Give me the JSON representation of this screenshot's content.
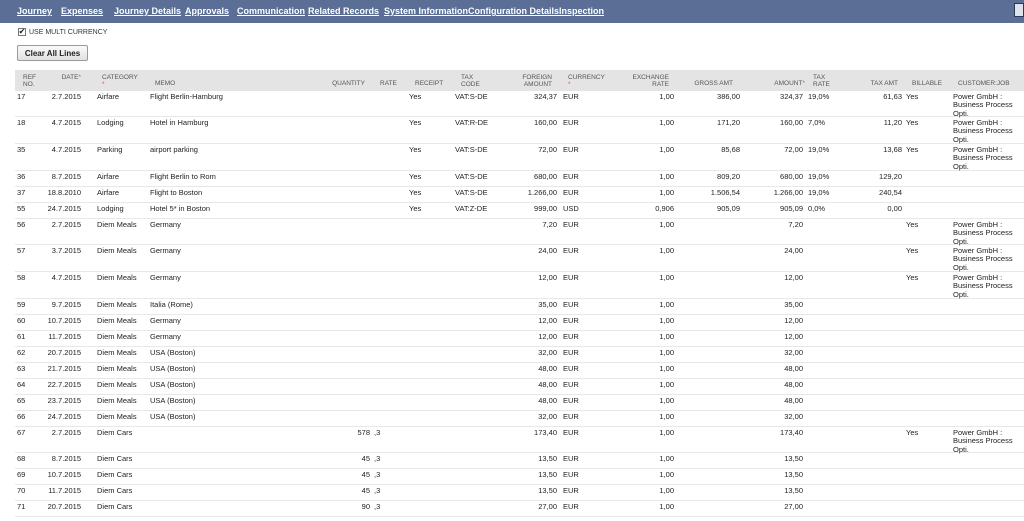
{
  "tabs": [
    {
      "label": "Journey",
      "active": false
    },
    {
      "label": "Expenses",
      "active": true
    },
    {
      "label": "Journey Details",
      "active": false
    },
    {
      "label": "Approvals",
      "active": false
    },
    {
      "label": "Communication",
      "active": false
    },
    {
      "label": "Related Records",
      "active": false
    },
    {
      "label": "System Information",
      "active": false
    },
    {
      "label": "Configuration Details",
      "active": false
    },
    {
      "label": "Inspection",
      "active": false
    }
  ],
  "multi_currency": {
    "label": "USE MULTI CURRENCY",
    "checked": true,
    "check_glyph": "✔"
  },
  "clear_all_lines_label": "Clear All Lines",
  "required_mark": "*",
  "columns": {
    "ref": "REF NO.",
    "date": "DATE",
    "category": "CATEGORY",
    "memo": "MEMO",
    "quantity": "QUANTITY",
    "rate": "RATE",
    "receipt": "RECEIPT",
    "tax_code": "TAX CODE",
    "foreign_amount": "FOREIGN AMOUNT",
    "currency": "CURRENCY",
    "exchange_rate": "EXCHANGE RATE",
    "gross_amt": "GROSS AMT",
    "amount": "AMOUNT",
    "tax_rate": "TAX RATE",
    "tax_amt": "TAX AMT",
    "billable": "BILLABLE",
    "customer_job": "CUSTOMER:JOB"
  },
  "rows": [
    {
      "ref": "17",
      "date": "2.7.2015",
      "category": "Airfare",
      "memo": "Flight Berlin-Hamburg",
      "quantity": "",
      "rate": "",
      "receipt": "Yes",
      "tax_code": "VAT:S-DE",
      "foreign_amount": "324,37",
      "currency": "EUR",
      "exchange_rate": "1,00",
      "gross_amt": "386,00",
      "amount": "324,37",
      "tax_rate": "19,0%",
      "tax_amt": "61,63",
      "billable": "Yes",
      "customer_job": "Power GmbH : Business Process Opti."
    },
    {
      "ref": "18",
      "date": "4.7.2015",
      "category": "Lodging",
      "memo": "Hotel in Hamburg",
      "quantity": "",
      "rate": "",
      "receipt": "Yes",
      "tax_code": "VAT:R-DE",
      "foreign_amount": "160,00",
      "currency": "EUR",
      "exchange_rate": "1,00",
      "gross_amt": "171,20",
      "amount": "160,00",
      "tax_rate": "7,0%",
      "tax_amt": "11,20",
      "billable": "Yes",
      "customer_job": "Power GmbH : Business Process Opti."
    },
    {
      "ref": "35",
      "date": "4.7.2015",
      "category": "Parking",
      "memo": "airport parking",
      "quantity": "",
      "rate": "",
      "receipt": "Yes",
      "tax_code": "VAT:S-DE",
      "foreign_amount": "72,00",
      "currency": "EUR",
      "exchange_rate": "1,00",
      "gross_amt": "85,68",
      "amount": "72,00",
      "tax_rate": "19,0%",
      "tax_amt": "13,68",
      "billable": "Yes",
      "customer_job": "Power GmbH : Business Process Opti."
    },
    {
      "ref": "36",
      "date": "8.7.2015",
      "category": "Airfare",
      "memo": "Flight Berlin to Rom",
      "quantity": "",
      "rate": "",
      "receipt": "Yes",
      "tax_code": "VAT:S-DE",
      "foreign_amount": "680,00",
      "currency": "EUR",
      "exchange_rate": "1,00",
      "gross_amt": "809,20",
      "amount": "680,00",
      "tax_rate": "19,0%",
      "tax_amt": "129,20",
      "billable": "",
      "customer_job": ""
    },
    {
      "ref": "37",
      "date": "18.8.2010",
      "category": "Airfare",
      "memo": "Flight to Boston",
      "quantity": "",
      "rate": "",
      "receipt": "Yes",
      "tax_code": "VAT:S-DE",
      "foreign_amount": "1.266,00",
      "currency": "EUR",
      "exchange_rate": "1,00",
      "gross_amt": "1.506,54",
      "amount": "1.266,00",
      "tax_rate": "19,0%",
      "tax_amt": "240,54",
      "billable": "",
      "customer_job": ""
    },
    {
      "ref": "55",
      "date": "24.7.2015",
      "category": "Lodging",
      "memo": "Hotel 5* in Boston",
      "quantity": "",
      "rate": "",
      "receipt": "Yes",
      "tax_code": "VAT:Z-DE",
      "foreign_amount": "999,00",
      "currency": "USD",
      "exchange_rate": "0,906",
      "gross_amt": "905,09",
      "amount": "905,09",
      "tax_rate": "0,0%",
      "tax_amt": "0,00",
      "billable": "",
      "customer_job": ""
    },
    {
      "ref": "56",
      "date": "2.7.2015",
      "category": "Diem Meals",
      "memo": "Germany",
      "quantity": "",
      "rate": "",
      "receipt": "",
      "tax_code": "",
      "foreign_amount": "7,20",
      "currency": "EUR",
      "exchange_rate": "1,00",
      "gross_amt": "",
      "amount": "7,20",
      "tax_rate": "",
      "tax_amt": "",
      "billable": "Yes",
      "customer_job": "Power GmbH : Business Process Opti."
    },
    {
      "ref": "57",
      "date": "3.7.2015",
      "category": "Diem Meals",
      "memo": "Germany",
      "quantity": "",
      "rate": "",
      "receipt": "",
      "tax_code": "",
      "foreign_amount": "24,00",
      "currency": "EUR",
      "exchange_rate": "1,00",
      "gross_amt": "",
      "amount": "24,00",
      "tax_rate": "",
      "tax_amt": "",
      "billable": "Yes",
      "customer_job": "Power GmbH : Business Process Opti."
    },
    {
      "ref": "58",
      "date": "4.7.2015",
      "category": "Diem Meals",
      "memo": "Germany",
      "quantity": "",
      "rate": "",
      "receipt": "",
      "tax_code": "",
      "foreign_amount": "12,00",
      "currency": "EUR",
      "exchange_rate": "1,00",
      "gross_amt": "",
      "amount": "12,00",
      "tax_rate": "",
      "tax_amt": "",
      "billable": "Yes",
      "customer_job": "Power GmbH : Business Process Opti."
    },
    {
      "ref": "59",
      "date": "9.7.2015",
      "category": "Diem Meals",
      "memo": "Italia (Rome)",
      "quantity": "",
      "rate": "",
      "receipt": "",
      "tax_code": "",
      "foreign_amount": "35,00",
      "currency": "EUR",
      "exchange_rate": "1,00",
      "gross_amt": "",
      "amount": "35,00",
      "tax_rate": "",
      "tax_amt": "",
      "billable": "",
      "customer_job": ""
    },
    {
      "ref": "60",
      "date": "10.7.2015",
      "category": "Diem Meals",
      "memo": "Germany",
      "quantity": "",
      "rate": "",
      "receipt": "",
      "tax_code": "",
      "foreign_amount": "12,00",
      "currency": "EUR",
      "exchange_rate": "1,00",
      "gross_amt": "",
      "amount": "12,00",
      "tax_rate": "",
      "tax_amt": "",
      "billable": "",
      "customer_job": ""
    },
    {
      "ref": "61",
      "date": "11.7.2015",
      "category": "Diem Meals",
      "memo": "Germany",
      "quantity": "",
      "rate": "",
      "receipt": "",
      "tax_code": "",
      "foreign_amount": "12,00",
      "currency": "EUR",
      "exchange_rate": "1,00",
      "gross_amt": "",
      "amount": "12,00",
      "tax_rate": "",
      "tax_amt": "",
      "billable": "",
      "customer_job": ""
    },
    {
      "ref": "62",
      "date": "20.7.2015",
      "category": "Diem Meals",
      "memo": "USA (Boston)",
      "quantity": "",
      "rate": "",
      "receipt": "",
      "tax_code": "",
      "foreign_amount": "32,00",
      "currency": "EUR",
      "exchange_rate": "1,00",
      "gross_amt": "",
      "amount": "32,00",
      "tax_rate": "",
      "tax_amt": "",
      "billable": "",
      "customer_job": ""
    },
    {
      "ref": "63",
      "date": "21.7.2015",
      "category": "Diem Meals",
      "memo": "USA (Boston)",
      "quantity": "",
      "rate": "",
      "receipt": "",
      "tax_code": "",
      "foreign_amount": "48,00",
      "currency": "EUR",
      "exchange_rate": "1,00",
      "gross_amt": "",
      "amount": "48,00",
      "tax_rate": "",
      "tax_amt": "",
      "billable": "",
      "customer_job": ""
    },
    {
      "ref": "64",
      "date": "22.7.2015",
      "category": "Diem Meals",
      "memo": "USA (Boston)",
      "quantity": "",
      "rate": "",
      "receipt": "",
      "tax_code": "",
      "foreign_amount": "48,00",
      "currency": "EUR",
      "exchange_rate": "1,00",
      "gross_amt": "",
      "amount": "48,00",
      "tax_rate": "",
      "tax_amt": "",
      "billable": "",
      "customer_job": ""
    },
    {
      "ref": "65",
      "date": "23.7.2015",
      "category": "Diem Meals",
      "memo": "USA (Boston)",
      "quantity": "",
      "rate": "",
      "receipt": "",
      "tax_code": "",
      "foreign_amount": "48,00",
      "currency": "EUR",
      "exchange_rate": "1,00",
      "gross_amt": "",
      "amount": "48,00",
      "tax_rate": "",
      "tax_amt": "",
      "billable": "",
      "customer_job": ""
    },
    {
      "ref": "66",
      "date": "24.7.2015",
      "category": "Diem Meals",
      "memo": "USA (Boston)",
      "quantity": "",
      "rate": "",
      "receipt": "",
      "tax_code": "",
      "foreign_amount": "32,00",
      "currency": "EUR",
      "exchange_rate": "1,00",
      "gross_amt": "",
      "amount": "32,00",
      "tax_rate": "",
      "tax_amt": "",
      "billable": "",
      "customer_job": ""
    },
    {
      "ref": "67",
      "date": "2.7.2015",
      "category": "Diem Cars",
      "memo": "",
      "quantity": "578",
      "rate": ",3",
      "receipt": "",
      "tax_code": "",
      "foreign_amount": "173,40",
      "currency": "EUR",
      "exchange_rate": "1,00",
      "gross_amt": "",
      "amount": "173,40",
      "tax_rate": "",
      "tax_amt": "",
      "billable": "Yes",
      "customer_job": "Power GmbH : Business Process Opti."
    },
    {
      "ref": "68",
      "date": "8.7.2015",
      "category": "Diem Cars",
      "memo": "",
      "quantity": "45",
      "rate": ",3",
      "receipt": "",
      "tax_code": "",
      "foreign_amount": "13,50",
      "currency": "EUR",
      "exchange_rate": "1,00",
      "gross_amt": "",
      "amount": "13,50",
      "tax_rate": "",
      "tax_amt": "",
      "billable": "",
      "customer_job": ""
    },
    {
      "ref": "69",
      "date": "10.7.2015",
      "category": "Diem Cars",
      "memo": "",
      "quantity": "45",
      "rate": ",3",
      "receipt": "",
      "tax_code": "",
      "foreign_amount": "13,50",
      "currency": "EUR",
      "exchange_rate": "1,00",
      "gross_amt": "",
      "amount": "13,50",
      "tax_rate": "",
      "tax_amt": "",
      "billable": "",
      "customer_job": ""
    },
    {
      "ref": "70",
      "date": "11.7.2015",
      "category": "Diem Cars",
      "memo": "",
      "quantity": "45",
      "rate": ",3",
      "receipt": "",
      "tax_code": "",
      "foreign_amount": "13,50",
      "currency": "EUR",
      "exchange_rate": "1,00",
      "gross_amt": "",
      "amount": "13,50",
      "tax_rate": "",
      "tax_amt": "",
      "billable": "",
      "customer_job": ""
    },
    {
      "ref": "71",
      "date": "20.7.2015",
      "category": "Diem Cars",
      "memo": "",
      "quantity": "90",
      "rate": ",3",
      "receipt": "",
      "tax_code": "",
      "foreign_amount": "27,00",
      "currency": "EUR",
      "exchange_rate": "1,00",
      "gross_amt": "",
      "amount": "27,00",
      "tax_rate": "",
      "tax_amt": "",
      "billable": "",
      "customer_job": ""
    }
  ]
}
